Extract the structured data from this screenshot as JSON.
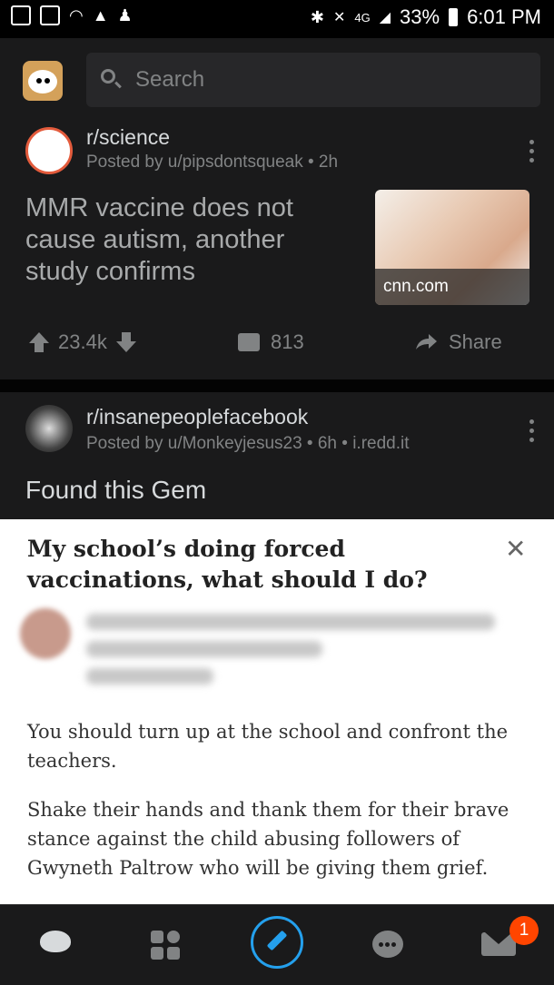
{
  "status_bar": {
    "battery": "33%",
    "time": "6:01 PM",
    "network": "4G"
  },
  "search": {
    "placeholder": "Search"
  },
  "posts": [
    {
      "subreddit": "r/science",
      "meta": "Posted by u/pipsdontsqueak • 2h",
      "title": "MMR vaccine does not cause autism, another study confirms",
      "link_domain": "cnn.com",
      "upvotes": "23.4k",
      "comments": "813",
      "share_label": "Share"
    },
    {
      "subreddit": "r/insanepeoplefacebook",
      "meta": "Posted by u/Monkeyjesus23 • 6h • i.redd.it",
      "title": "Found this Gem"
    }
  ],
  "image_content": {
    "question": "My school’s doing forced vaccinations, what should I do?",
    "answer_p1": "You should turn up at the school and confront the teachers.",
    "answer_p2": "Shake their hands and thank them for their brave stance against the child abusing followers of Gwyneth Paltrow who will be giving them grief."
  },
  "bottom_nav": {
    "inbox_badge": "1",
    "accent": "#24a0ed",
    "badge_color": "#ff4500"
  }
}
